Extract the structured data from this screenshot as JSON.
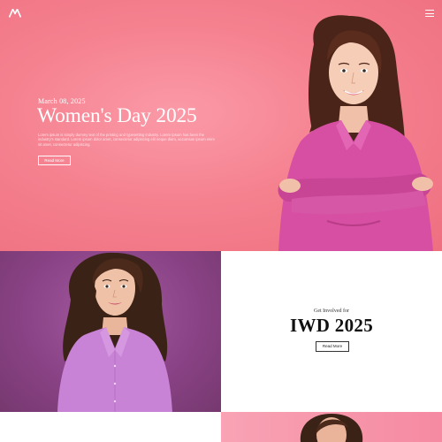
{
  "header": {
    "logo_icon": "m-monogram-logo",
    "menu_icon": "hamburger-menu-icon"
  },
  "hero": {
    "date": "March 08, 2025",
    "title": "Women's Day 2025",
    "description": "Lorem ipsum is simply dummy text of the printing and typesetting industry. Lorem Ipsum has been the industry's standard. Lorem ipsum dolor amet, consectetur adipiscing elit neque diam, accumsan ipsum enim sit amet, consectetur adipiscing.",
    "button_label": "Read More",
    "background_color": "#f5818f",
    "image_icon": "woman-portrait-photo"
  },
  "feature": {
    "image_icon": "woman-portrait-photo",
    "background_color": "#8a4386",
    "eyebrow": "Get Involved for",
    "title": "IWD 2025",
    "button_label": "Read More"
  },
  "next_section": {
    "background_color": "#f79ab0",
    "image_icon": "woman-portrait-photo"
  }
}
